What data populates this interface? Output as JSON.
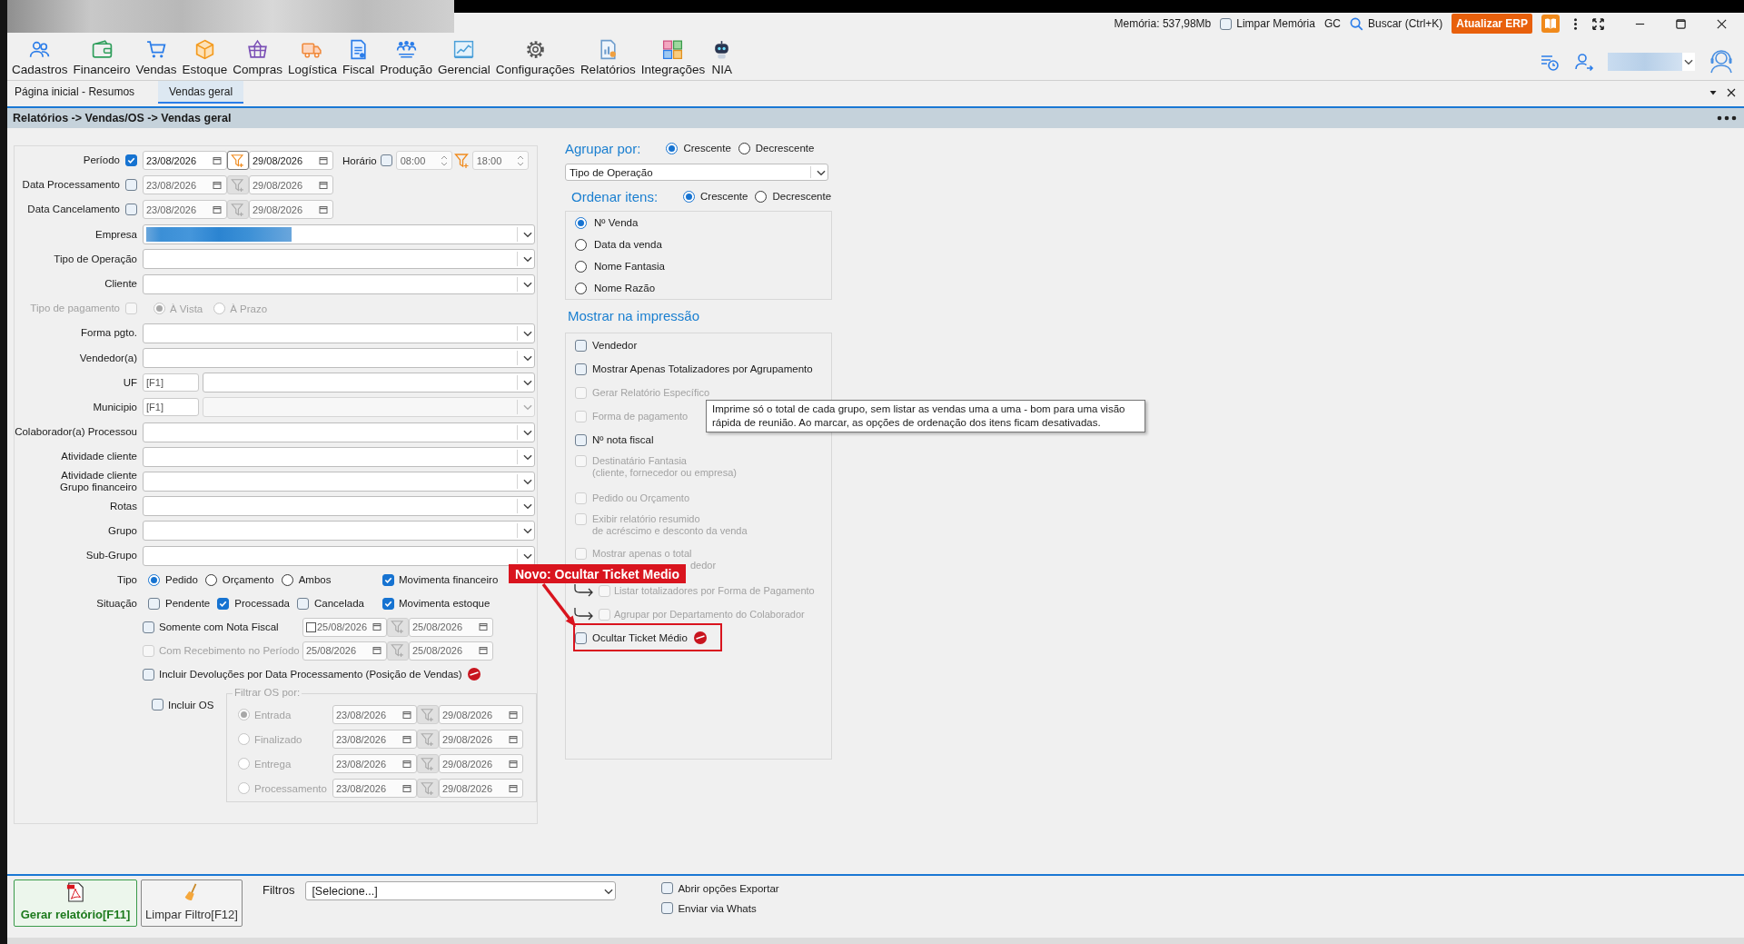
{
  "header": {
    "memory": "Memória: 537,98Mb",
    "clear_memory": {
      "label": "Limpar Memória",
      "checked": false
    },
    "gc": "GC",
    "search": "Buscar (Ctrl+K)",
    "update": "Atualizar ERP"
  },
  "toolbar": [
    {
      "label": "Cadastros"
    },
    {
      "label": "Financeiro"
    },
    {
      "label": "Vendas"
    },
    {
      "label": "Estoque"
    },
    {
      "label": "Compras"
    },
    {
      "label": "Logística"
    },
    {
      "label": "Fiscal"
    },
    {
      "label": "Produção"
    },
    {
      "label": "Gerencial"
    },
    {
      "label": "Configurações"
    },
    {
      "label": "Relatórios"
    },
    {
      "label": "Integrações"
    },
    {
      "label": "NIA"
    }
  ],
  "tabs": [
    {
      "label": "Página inicial - Resumos",
      "selected": false
    },
    {
      "label": "Vendas geral",
      "selected": true
    }
  ],
  "breadcrumb": "Relatórios -> Vendas/OS -> Vendas geral",
  "dates": [
    {
      "label": "Período",
      "checked": true,
      "disabled": false,
      "from": "23/08/2026",
      "to": "29/08/2026",
      "time": {
        "label": "Horário",
        "checked": false,
        "from": "08:00",
        "to": "18:00"
      }
    },
    {
      "label": "Data Processamento",
      "checked": false,
      "disabled": true,
      "from": "23/08/2026",
      "to": "29/08/2026"
    },
    {
      "label": "Data Cancelamento",
      "checked": false,
      "disabled": true,
      "from": "23/08/2026",
      "to": "29/08/2026"
    }
  ],
  "fields": [
    {
      "kind": "combo",
      "label": "Empresa",
      "masked": true
    },
    {
      "kind": "combo",
      "label": "Tipo de Operação"
    },
    {
      "kind": "combo",
      "label": "Cliente"
    },
    {
      "kind": "payment",
      "label": "Tipo de pagamento",
      "checked": false,
      "options": [
        {
          "label": "À Vista",
          "selected": true
        },
        {
          "label": "À Prazo",
          "selected": false
        }
      ]
    },
    {
      "kind": "combo",
      "label": "Forma pgto."
    },
    {
      "kind": "combo",
      "label": "Vendedor(a)"
    },
    {
      "kind": "code",
      "label": "UF",
      "code": "[F1]",
      "disabled": false
    },
    {
      "kind": "code",
      "label": "Municipio",
      "code": "[F1]",
      "disabled": true
    },
    {
      "kind": "combo",
      "label": "Colaborador(a) Processou"
    },
    {
      "kind": "combo",
      "label": "Atividade cliente"
    },
    {
      "kind": "combo",
      "label": "Atividade cliente\nGrupo financeiro"
    },
    {
      "kind": "combo",
      "label": "Rotas"
    },
    {
      "kind": "combo",
      "label": "Grupo"
    },
    {
      "kind": "combo",
      "label": "Sub-Grupo"
    }
  ],
  "tipo": {
    "label": "Tipo",
    "options": [
      {
        "label": "Pedido",
        "selected": true
      },
      {
        "label": "Orçamento",
        "selected": false
      },
      {
        "label": "Ambos",
        "selected": false
      }
    ]
  },
  "situacao": {
    "label": "Situação",
    "options": [
      {
        "label": "Pendente",
        "checked": false
      },
      {
        "label": "Processada",
        "checked": true
      },
      {
        "label": "Cancelada",
        "checked": false
      }
    ]
  },
  "movimenta": [
    {
      "label": "Movimenta financeiro",
      "checked": true
    },
    {
      "label": "Movimenta estoque",
      "checked": true
    }
  ],
  "extra_filters": [
    {
      "label": "Somente com Nota Fiscal",
      "checked": false,
      "disabled": false,
      "from_checked": false,
      "from": "25/08/2026",
      "to": "25/08/2026"
    },
    {
      "label": "Com Recebimento no Período",
      "checked": false,
      "disabled": true,
      "from": "25/08/2026",
      "to": "25/08/2026"
    }
  ],
  "devolucoes": {
    "label": "Incluir Devoluções por Data Processamento (Posição de Vendas)",
    "checked": false,
    "is_new": true
  },
  "os": {
    "label": "Incluir OS",
    "checked": false,
    "group_title": "Filtrar OS por:",
    "options": [
      {
        "label": "Entrada",
        "selected": true,
        "from": "23/08/2026",
        "to": "29/08/2026"
      },
      {
        "label": "Finalizado",
        "selected": false,
        "from": "23/08/2026",
        "to": "29/08/2026"
      },
      {
        "label": "Entrega",
        "selected": false,
        "from": "23/08/2026",
        "to": "29/08/2026"
      },
      {
        "label": "Processamento",
        "selected": false,
        "from": "23/08/2026",
        "to": "29/08/2026"
      }
    ]
  },
  "grouping": {
    "title": "Agrupar por:",
    "order": [
      {
        "label": "Crescente",
        "selected": true
      },
      {
        "label": "Decrescente",
        "selected": false
      }
    ],
    "value": "Tipo de Operação"
  },
  "sorting": {
    "title": "Ordenar itens:",
    "order": [
      {
        "label": "Crescente",
        "selected": true
      },
      {
        "label": "Decrescente",
        "selected": false
      }
    ],
    "items": [
      {
        "label": "Nº Venda",
        "selected": true
      },
      {
        "label": "Data da venda",
        "selected": false
      },
      {
        "label": "Nome Fantasia",
        "selected": false
      },
      {
        "label": "Nome Razão",
        "selected": false
      }
    ]
  },
  "print": {
    "title": "Mostrar na impressão",
    "items": [
      {
        "kind": "plain",
        "lines": [
          "Vendedor"
        ],
        "checked": false,
        "disabled": false
      },
      {
        "kind": "plain",
        "lines": [
          "Mostrar Apenas Totalizadores por Agrupamento"
        ],
        "checked": false,
        "disabled": false
      },
      {
        "kind": "plain",
        "lines": [
          "Gerar Relatório Específico"
        ],
        "checked": false,
        "disabled": true
      },
      {
        "kind": "plain",
        "lines": [
          "Forma de pagamento"
        ],
        "checked": false,
        "disabled": true
      },
      {
        "kind": "plain",
        "lines": [
          "Nº nota fiscal"
        ],
        "checked": false,
        "disabled": false
      },
      {
        "kind": "plain",
        "lines": [
          "Destinatário Fantasia",
          "(cliente, fornecedor ou empresa)"
        ],
        "checked": false,
        "disabled": true
      },
      {
        "kind": "plain",
        "lines": [
          "Pedido ou Orçamento"
        ],
        "checked": false,
        "disabled": true
      },
      {
        "kind": "plain",
        "lines": [
          "Exibir relatório resumido",
          "de acréscimo e desconto da venda"
        ],
        "checked": false,
        "disabled": true
      },
      {
        "kind": "covered",
        "lines": [
          "Mostrar apenas o total",
          "dedor"
        ],
        "checked": false,
        "disabled": true
      },
      {
        "kind": "sub",
        "lines": [
          "Listar totalizadores por Forma de Pagamento"
        ],
        "checked": false,
        "disabled": true
      },
      {
        "kind": "sub",
        "lines": [
          "Agrupar por Departamento do Colaborador"
        ],
        "checked": false,
        "disabled": true
      },
      {
        "kind": "plain",
        "lines": [
          "Ocultar Ticket Médio"
        ],
        "checked": false,
        "disabled": false,
        "is_new": true
      }
    ]
  },
  "tooltip": "Imprime só o total de cada grupo, sem listar as vendas uma a uma - bom para uma visão rápida de reunião. Ao marcar, as opções de ordenação dos itens ficam desativadas.",
  "annotation": "Novo: Ocultar Ticket Medio",
  "footer": {
    "buttons": [
      {
        "kind": "primary",
        "label": "Gerar relatório[F11]"
      },
      {
        "kind": "secondary",
        "label": "Limpar Filtro[F12]"
      }
    ],
    "filters_label": "Filtros",
    "filters_value": "[Selecione...]",
    "options": [
      {
        "label": "Abrir opções Exportar",
        "checked": false
      },
      {
        "label": "Enviar via Whats",
        "checked": false
      }
    ]
  }
}
